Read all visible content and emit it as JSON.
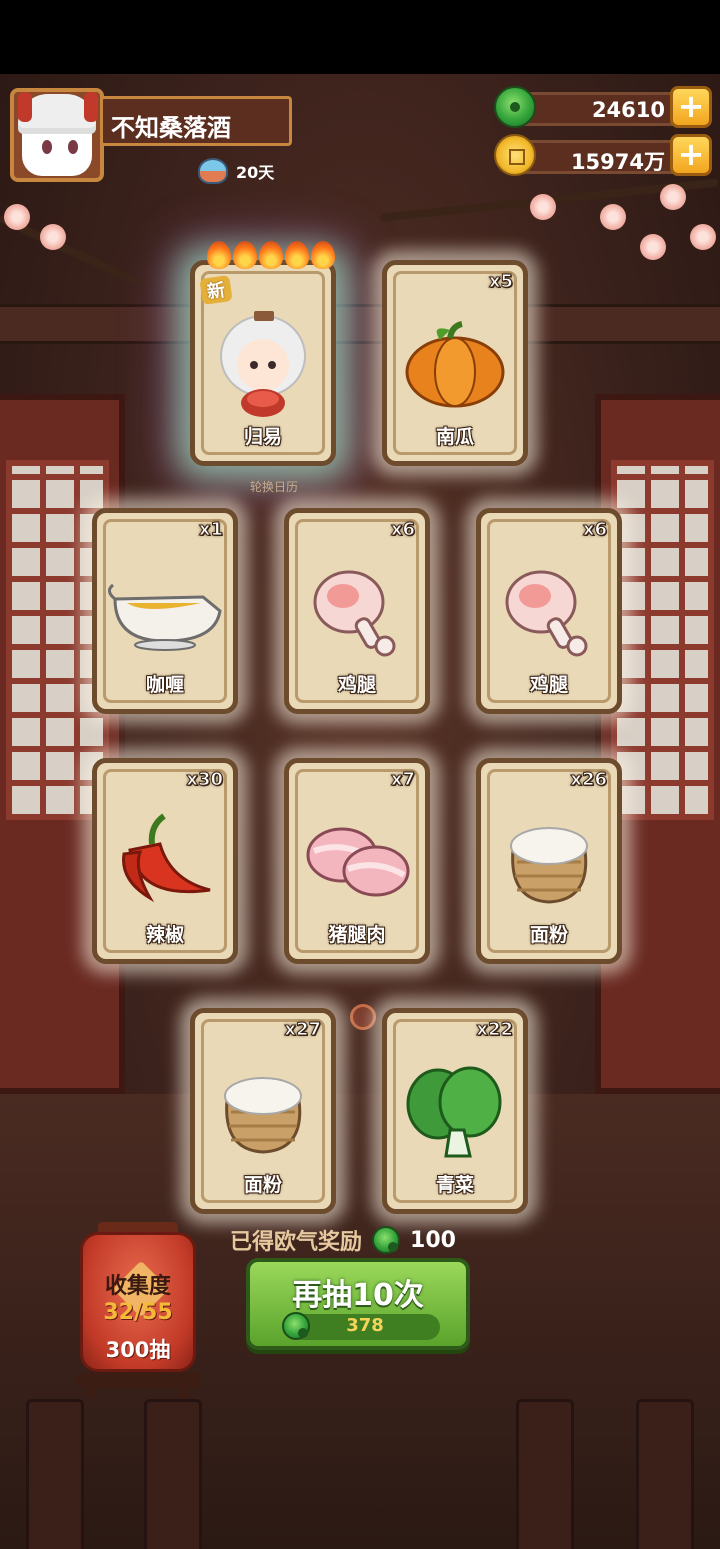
{
  "player": {
    "name": "不知桑落酒",
    "days": "20天"
  },
  "currency": {
    "jade": "24610",
    "coins": "15974万"
  },
  "featured_cards": [
    {
      "label": "归易",
      "count": "",
      "badge": "新",
      "type": "character"
    },
    {
      "label": "南瓜",
      "count": "x5",
      "type": "pumpkin"
    }
  ],
  "calendar_label": "轮换日历",
  "cards": [
    {
      "label": "咖喱",
      "count": "x1",
      "type": "curry"
    },
    {
      "label": "鸡腿",
      "count": "x6",
      "type": "drumstick"
    },
    {
      "label": "鸡腿",
      "count": "x6",
      "type": "drumstick"
    },
    {
      "label": "辣椒",
      "count": "x30",
      "type": "chili"
    },
    {
      "label": "猪腿肉",
      "count": "x7",
      "type": "pork"
    },
    {
      "label": "面粉",
      "count": "x26",
      "type": "flour"
    },
    {
      "label": "面粉",
      "count": "x27",
      "type": "flour"
    },
    {
      "label": "青菜",
      "count": "x22",
      "type": "greens"
    }
  ],
  "reward": {
    "label": "已得欧气奖励",
    "value": "100"
  },
  "collection": {
    "label": "收集度",
    "progress": "32/55",
    "pulls": "300抽"
  },
  "draw_button": {
    "label": "再抽10次",
    "cost": "378"
  }
}
